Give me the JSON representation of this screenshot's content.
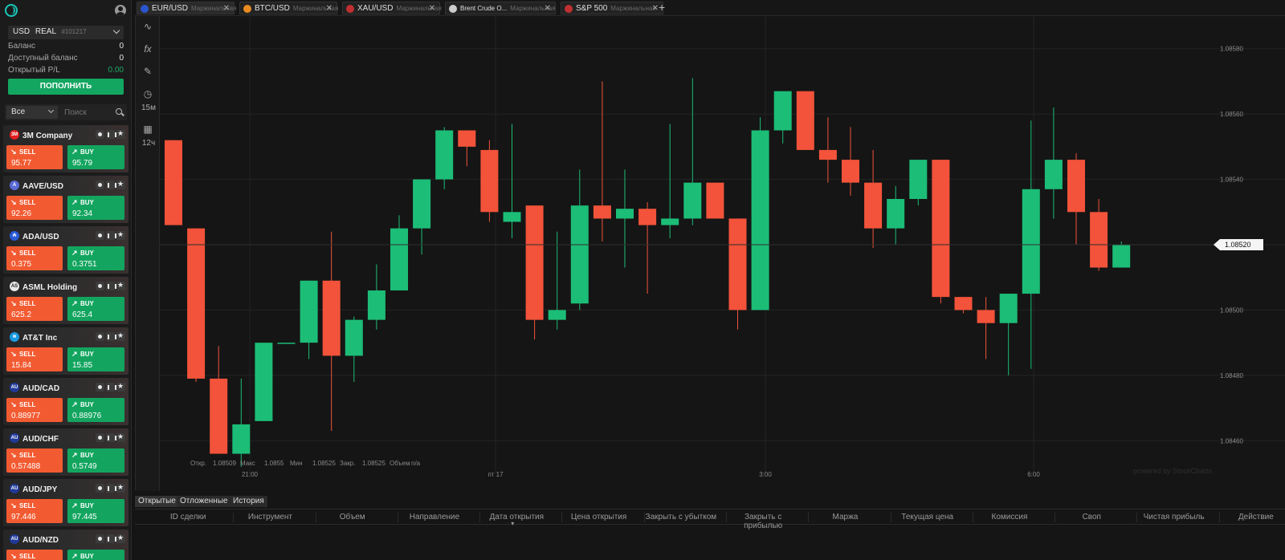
{
  "account": {
    "currency": "USD",
    "type": "REAL",
    "number": "#101217",
    "balance_label": "Баланс",
    "balance": "0",
    "available_label": "Доступный баланс",
    "available": "0",
    "pl_label": "Открытый P/L",
    "pl": "0.00",
    "deposit_label": "ПОПОЛНИТЬ"
  },
  "filter": {
    "selected": "Все",
    "search_placeholder": "Поиск"
  },
  "instruments": [
    {
      "name": "3M Company",
      "sell": "95.77",
      "buy": "95.79",
      "logo": "3M",
      "color": "#e02020"
    },
    {
      "name": "AAVE/USD",
      "sell": "92.26",
      "buy": "92.34",
      "logo": "A",
      "color": "#5a6ad8"
    },
    {
      "name": "ADA/USD",
      "sell": "0.375",
      "buy": "0.3751",
      "logo": "₳",
      "color": "#2a5ad8"
    },
    {
      "name": "ASML Holding",
      "sell": "625.2",
      "buy": "625.4",
      "logo": "AS",
      "color": "#e8e8e8"
    },
    {
      "name": "AT&T Inc",
      "sell": "15.84",
      "buy": "15.85",
      "logo": "≋",
      "color": "#1a9ae0"
    },
    {
      "name": "AUD/CAD",
      "sell": "0.88977",
      "buy": "0.88976",
      "logo": "AU",
      "color": "#203a9a"
    },
    {
      "name": "AUD/CHF",
      "sell": "0.57488",
      "buy": "0.5749",
      "logo": "AU",
      "color": "#203a9a"
    },
    {
      "name": "AUD/JPY",
      "sell": "97.446",
      "buy": "97.445",
      "logo": "AU",
      "color": "#203a9a"
    },
    {
      "name": "AUD/NZD",
      "sell": "",
      "buy": "",
      "logo": "AU",
      "color": "#203a9a"
    }
  ],
  "labels": {
    "sell": "SELL",
    "buy": "BUY"
  },
  "tabs": [
    {
      "symbol": "EUR/USD",
      "sub": "Маржинальная",
      "icon": "eu-flag-icon",
      "color": "#2a55d0"
    },
    {
      "symbol": "BTC/USD",
      "sub": "Маржинальная",
      "icon": "bitcoin-icon",
      "color": "#e88a20"
    },
    {
      "symbol": "XAU/USD",
      "sub": "Маржинальная",
      "icon": "us-flag-icon",
      "color": "#c03030"
    },
    {
      "symbol": "Brent Crude O...",
      "sub": "Маржинальная",
      "icon": "oil-drop-icon",
      "color": "#cccccc"
    },
    {
      "symbol": "S&P 500",
      "sub": "Маржинальная",
      "icon": "us-flag-icon",
      "color": "#c03030"
    }
  ],
  "toolbar": {
    "interval": "15м",
    "range": "12ч"
  },
  "chart_data": {
    "type": "candlestick",
    "x_ticks": [
      "21:00",
      "пт 17",
      "3:00",
      "6:00"
    ],
    "y_ticks": [
      "1.08580",
      "1.08560",
      "1.08540",
      "1.08520",
      "1.08500",
      "1.08480",
      "1.08460"
    ],
    "ylim": [
      1.0845,
      1.0859
    ],
    "current_price": "1.08520",
    "watermark": "powered by StockCharts",
    "ohlc_legend": {
      "open_label": "Откр.",
      "open": "1.08509",
      "high_label": "Макс",
      "high": "1.0855",
      "low_label": "Мин",
      "low": "1.08525",
      "close_label": "Закр.",
      "close": "1.08525",
      "volume_label": "Объем",
      "volume": "n/a"
    },
    "candles": [
      {
        "o": 1.08552,
        "h": 1.08552,
        "l": 1.08526,
        "c": 1.08526
      },
      {
        "o": 1.08525,
        "h": 1.08525,
        "l": 1.08478,
        "c": 1.08479
      },
      {
        "o": 1.08479,
        "h": 1.08489,
        "l": 1.08456,
        "c": 1.08456
      },
      {
        "o": 1.08456,
        "h": 1.08479,
        "l": 1.08452,
        "c": 1.08465
      },
      {
        "o": 1.08466,
        "h": 1.0849,
        "l": 1.08466,
        "c": 1.0849
      },
      {
        "o": 1.0849,
        "h": 1.0849,
        "l": 1.0849,
        "c": 1.0849
      },
      {
        "o": 1.0849,
        "h": 1.08509,
        "l": 1.08485,
        "c": 1.08509
      },
      {
        "o": 1.08509,
        "h": 1.08524,
        "l": 1.08463,
        "c": 1.08486
      },
      {
        "o": 1.08486,
        "h": 1.08498,
        "l": 1.08478,
        "c": 1.08497
      },
      {
        "o": 1.08497,
        "h": 1.08514,
        "l": 1.08494,
        "c": 1.08506
      },
      {
        "o": 1.08506,
        "h": 1.08529,
        "l": 1.08506,
        "c": 1.08525
      },
      {
        "o": 1.08525,
        "h": 1.0854,
        "l": 1.08517,
        "c": 1.0854
      },
      {
        "o": 1.0854,
        "h": 1.08556,
        "l": 1.08537,
        "c": 1.08555
      },
      {
        "o": 1.08555,
        "h": 1.08555,
        "l": 1.08544,
        "c": 1.0855
      },
      {
        "o": 1.08549,
        "h": 1.08552,
        "l": 1.08527,
        "c": 1.0853
      },
      {
        "o": 1.08527,
        "h": 1.08557,
        "l": 1.08522,
        "c": 1.0853
      },
      {
        "o": 1.08532,
        "h": 1.08532,
        "l": 1.08491,
        "c": 1.08497
      },
      {
        "o": 1.08497,
        "h": 1.08524,
        "l": 1.08494,
        "c": 1.085
      },
      {
        "o": 1.08502,
        "h": 1.08543,
        "l": 1.085,
        "c": 1.08532
      },
      {
        "o": 1.08532,
        "h": 1.0857,
        "l": 1.08521,
        "c": 1.08528
      },
      {
        "o": 1.08528,
        "h": 1.08543,
        "l": 1.08513,
        "c": 1.08531
      },
      {
        "o": 1.08531,
        "h": 1.08533,
        "l": 1.08505,
        "c": 1.08526
      },
      {
        "o": 1.08526,
        "h": 1.08557,
        "l": 1.08522,
        "c": 1.08528
      },
      {
        "o": 1.08528,
        "h": 1.08571,
        "l": 1.08526,
        "c": 1.08539
      },
      {
        "o": 1.08539,
        "h": 1.08539,
        "l": 1.08529,
        "c": 1.08528
      },
      {
        "o": 1.08528,
        "h": 1.08528,
        "l": 1.08494,
        "c": 1.085
      },
      {
        "o": 1.085,
        "h": 1.08559,
        "l": 1.085,
        "c": 1.08555
      },
      {
        "o": 1.08555,
        "h": 1.08567,
        "l": 1.08551,
        "c": 1.08567
      },
      {
        "o": 1.08567,
        "h": 1.08567,
        "l": 1.08549,
        "c": 1.08549
      },
      {
        "o": 1.08549,
        "h": 1.08559,
        "l": 1.08539,
        "c": 1.08546
      },
      {
        "o": 1.08546,
        "h": 1.08556,
        "l": 1.08535,
        "c": 1.08539
      },
      {
        "o": 1.08539,
        "h": 1.08549,
        "l": 1.08519,
        "c": 1.08525
      },
      {
        "o": 1.08525,
        "h": 1.08538,
        "l": 1.0852,
        "c": 1.08534
      },
      {
        "o": 1.08534,
        "h": 1.08546,
        "l": 1.08532,
        "c": 1.08546
      },
      {
        "o": 1.08546,
        "h": 1.08546,
        "l": 1.08502,
        "c": 1.08504
      },
      {
        "o": 1.08504,
        "h": 1.08504,
        "l": 1.08499,
        "c": 1.085
      },
      {
        "o": 1.085,
        "h": 1.08504,
        "l": 1.08485,
        "c": 1.08496
      },
      {
        "o": 1.08496,
        "h": 1.08505,
        "l": 1.0848,
        "c": 1.08505
      },
      {
        "o": 1.08505,
        "h": 1.08558,
        "l": 1.08482,
        "c": 1.08537
      },
      {
        "o": 1.08537,
        "h": 1.08562,
        "l": 1.08528,
        "c": 1.08546
      },
      {
        "o": 1.08546,
        "h": 1.08548,
        "l": 1.0852,
        "c": 1.0853
      },
      {
        "o": 1.0853,
        "h": 1.08534,
        "l": 1.08512,
        "c": 1.08513
      },
      {
        "o": 1.08513,
        "h": 1.08521,
        "l": 1.08513,
        "c": 1.0852
      }
    ]
  },
  "bottom": {
    "tabs": [
      "Открытые",
      "Отложенные",
      "История"
    ],
    "columns": [
      "ID сделки",
      "Инструмент",
      "Объем",
      "Направление",
      "Дата открытия",
      "Цена открытия",
      "Закрыть с убытком",
      "Закрыть с прибылью",
      "Маржа",
      "Текущая цена",
      "Комиссия",
      "Своп",
      "Чистая прибыль",
      "Действие"
    ]
  }
}
